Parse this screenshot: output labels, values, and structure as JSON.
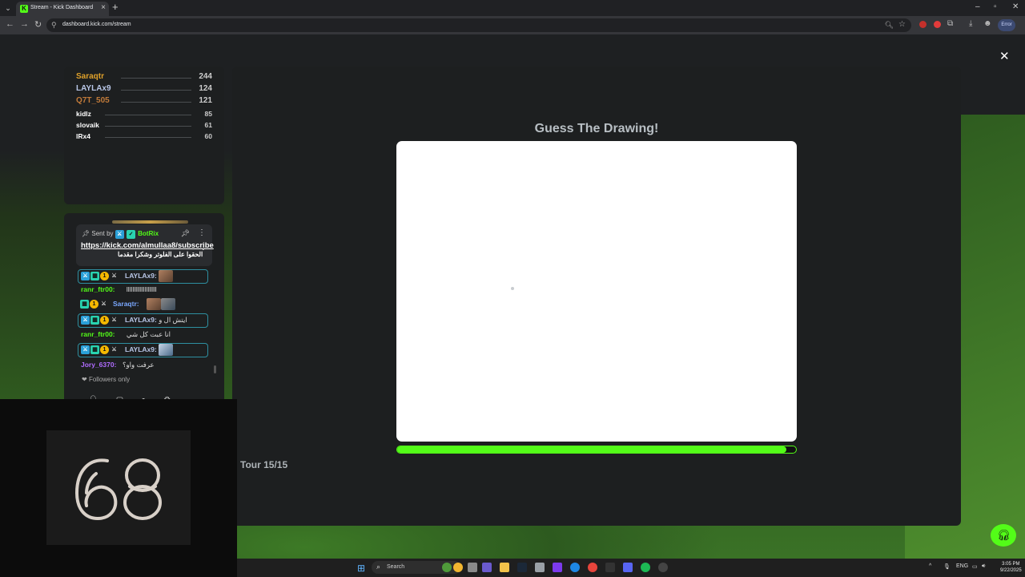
{
  "browser": {
    "tab_title": "Stream - Kick Dashboard",
    "favicon": "K",
    "url": "dashboard.kick.com/stream",
    "error_label": "Error"
  },
  "leaderboard": [
    {
      "name": "Saraqtr",
      "score": "244",
      "color": "#e0a12a"
    },
    {
      "name": "LAYLAx9",
      "score": "124",
      "color": "#b9c7e8"
    },
    {
      "name": "Q7T_505",
      "score": "121",
      "color": "#c07a3a"
    },
    {
      "name": "kidlz",
      "score": "85",
      "color": "#ffffff"
    },
    {
      "name": "slovaik",
      "score": "61",
      "color": "#ffffff"
    },
    {
      "name": "lRx4",
      "score": "60",
      "color": "#ffffff"
    }
  ],
  "chat": {
    "pinned": {
      "sent_by": "Sent by",
      "bot_name": "BotRix",
      "link": "https://kick.com/almullaa8/subscribe",
      "text": "الحقوا على الفلوتر وشكرا مقدما"
    },
    "messages": [
      {
        "user": "LAYLAx9:",
        "text": "",
        "user_color": "#b9c7e8",
        "highlight": true
      },
      {
        "user": "ranr_ftr00:",
        "text": "llllllllllllllllllll",
        "user_color": "#53fc18",
        "highlight": false
      },
      {
        "user": "Saraqtr:",
        "text": "",
        "user_color": "#7aa8ff",
        "highlight": false
      },
      {
        "user": "LAYLAx9:",
        "text": "ايتش ال و",
        "user_color": "#b9c7e8",
        "highlight": true
      },
      {
        "user": "ranr_ftr00:",
        "text": "انا عبت كل شي",
        "user_color": "#53fc18",
        "highlight": false
      },
      {
        "user": "LAYLAx9:",
        "text": "",
        "user_color": "#b9c7e8",
        "highlight": true
      },
      {
        "user": "Jory_6370:",
        "text": "عرفت واو؟",
        "user_color": "#b06cff",
        "highlight": false
      }
    ],
    "followers_only": "Followers only"
  },
  "game": {
    "title": "Guess The Drawing!",
    "round_label": "Tour 15/15",
    "timer_progress": 0.975,
    "accent_color": "#53fc18"
  },
  "webcam": {
    "logo_text": "68"
  },
  "taskbar": {
    "search_label": "Search",
    "language": "ENG",
    "time": "3:05 PM",
    "date": "9/22/2025"
  }
}
